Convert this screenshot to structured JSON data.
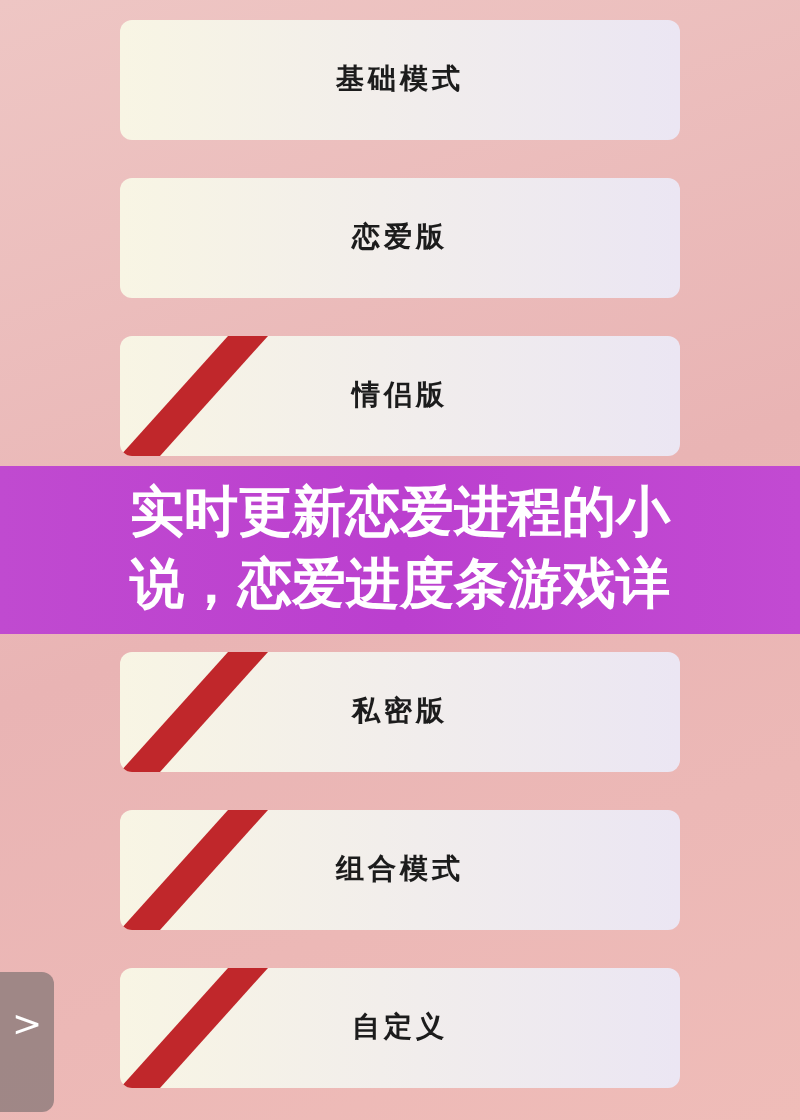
{
  "modes_top": [
    {
      "label": "基础模式",
      "striped": false
    },
    {
      "label": "恋爱版",
      "striped": false
    },
    {
      "label": "情侣版",
      "striped": true
    }
  ],
  "banner": {
    "title": "实时更新恋爱进程的小说，恋爱进度条游戏详"
  },
  "modes_bottom": [
    {
      "label": "私密版",
      "striped": true
    },
    {
      "label": "组合模式",
      "striped": true
    },
    {
      "label": "自定义",
      "striped": true
    }
  ],
  "side_tab": {
    "label": ">"
  }
}
